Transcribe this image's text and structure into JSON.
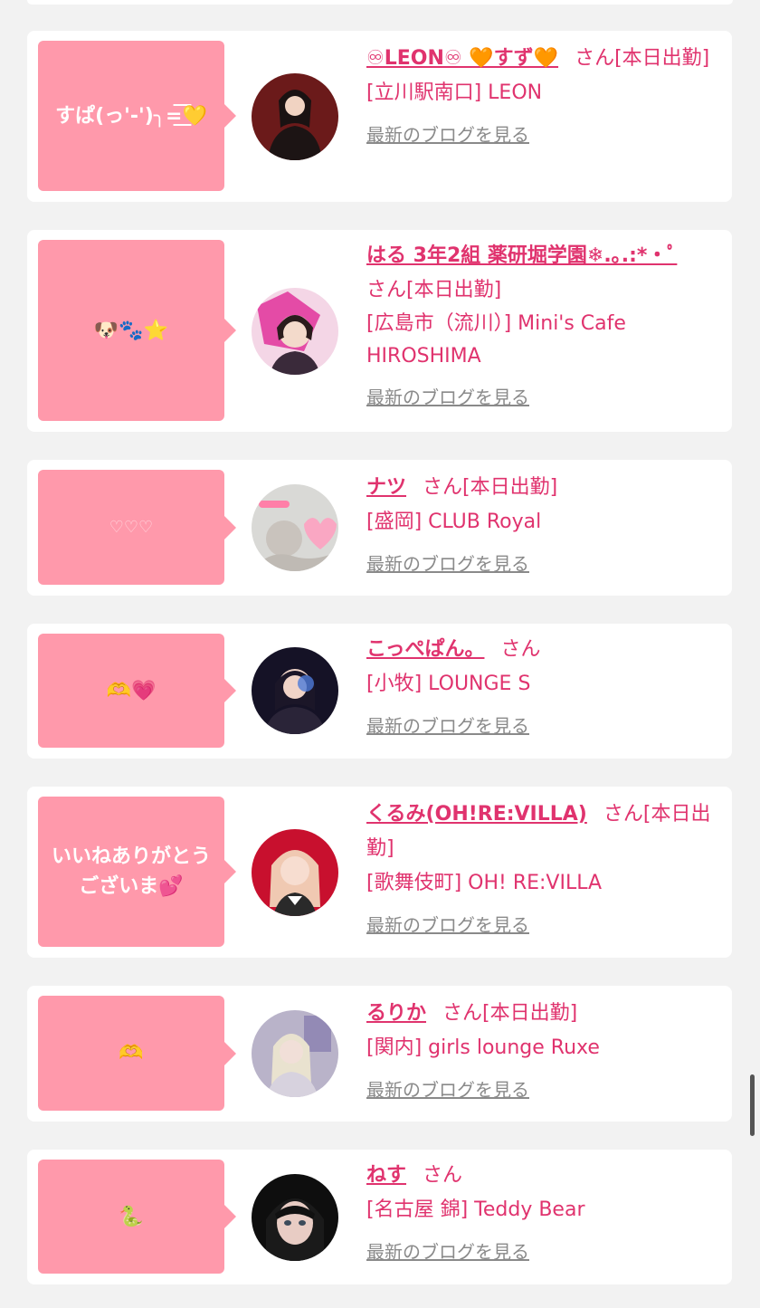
{
  "colors": {
    "page_bg": "#f2f2f2",
    "card_bg": "#ffffff",
    "bubble_bg": "#ff99ab",
    "name_text": "#e0336e",
    "blog_link": "#8a8a8a"
  },
  "entries": [
    {
      "bubble": "すぱ(っ'-')╮=͟͟͞͞💛",
      "name": "♾LEON♾ 🧡すず🧡",
      "san": "さん[本日出勤]",
      "shop": "[立川駅南口] LEON",
      "blog": "最新のブログを見る",
      "avatar_icon": "avatar-photo"
    },
    {
      "bubble": "🐶🐾⭐",
      "name": "はる 3年2組 薬研堀学園❄︎.｡.:*・ﾟ",
      "san": "さん[本日出勤]",
      "shop": "[広島市（流川）] Mini's Cafe HIROSHIMA",
      "blog": "最新のブログを見る",
      "avatar_icon": "avatar-photo"
    },
    {
      "bubble": "♡♡♡",
      "name": "ナツ",
      "san": "さん[本日出勤]",
      "shop": "[盛岡] CLUB Royal",
      "blog": "最新のブログを見る",
      "avatar_icon": "avatar-photo"
    },
    {
      "bubble": "🫶💗",
      "name": "こっぺぱん。",
      "san": "さん",
      "shop": "[小牧] LOUNGE S",
      "blog": "最新のブログを見る",
      "avatar_icon": "avatar-photo"
    },
    {
      "bubble": "いいねありがとうございま💕",
      "name": "くるみ(OH!RE:VILLA)",
      "san": "さん[本日出勤]",
      "shop": "[歌舞伎町] OH! RE:VILLA",
      "blog": "最新のブログを見る",
      "avatar_icon": "avatar-photo"
    },
    {
      "bubble": "🫶",
      "name": "るりか",
      "san": "さん[本日出勤]",
      "shop": "[関内] girls lounge Ruxe",
      "blog": "最新のブログを見る",
      "avatar_icon": "avatar-photo"
    },
    {
      "bubble": "🐍",
      "name": "ねす",
      "san": "さん",
      "shop": "[名古屋 錦] Teddy Bear",
      "blog": "最新のブログを見る",
      "avatar_icon": "avatar-photo"
    }
  ]
}
